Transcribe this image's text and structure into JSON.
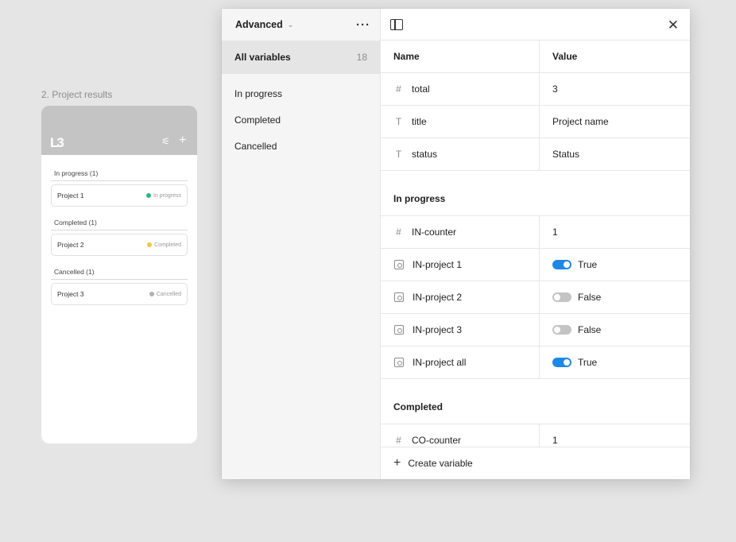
{
  "frame": {
    "label": "2. Project results",
    "logo": "LB",
    "sections": [
      {
        "title": "In progress (1)",
        "project": "Project 1",
        "status": "In progress",
        "color": "#2eb67d"
      },
      {
        "title": "Completed (1)",
        "project": "Project 2",
        "status": "Completed",
        "color": "#f5c542"
      },
      {
        "title": "Cancelled (1)",
        "project": "Project 3",
        "status": "Cancelled",
        "color": "#b0b0b0"
      }
    ]
  },
  "sidebar": {
    "collection": "Advanced",
    "all_label": "All variables",
    "all_count": "18",
    "items": [
      "In progress",
      "Completed",
      "Cancelled"
    ]
  },
  "table": {
    "col_name": "Name",
    "col_value": "Value",
    "rows": [
      {
        "name": "total",
        "value": "3"
      },
      {
        "name": "title",
        "value": "Project name"
      },
      {
        "name": "status",
        "value": "Status"
      }
    ],
    "group1": {
      "title": "In progress",
      "counter": {
        "name": "IN-counter",
        "value": "1"
      },
      "bools": [
        {
          "name": "IN-project 1",
          "value": "True"
        },
        {
          "name": "IN-project 2",
          "value": "False"
        },
        {
          "name": "IN-project 3",
          "value": "False"
        },
        {
          "name": "IN-project all",
          "value": "True"
        }
      ]
    },
    "group2": {
      "title": "Completed",
      "counter": {
        "name": "CO-counter",
        "value": "1"
      }
    }
  },
  "footer": {
    "create_label": "Create variable"
  },
  "colors": {
    "accent": "#1e88e5"
  }
}
